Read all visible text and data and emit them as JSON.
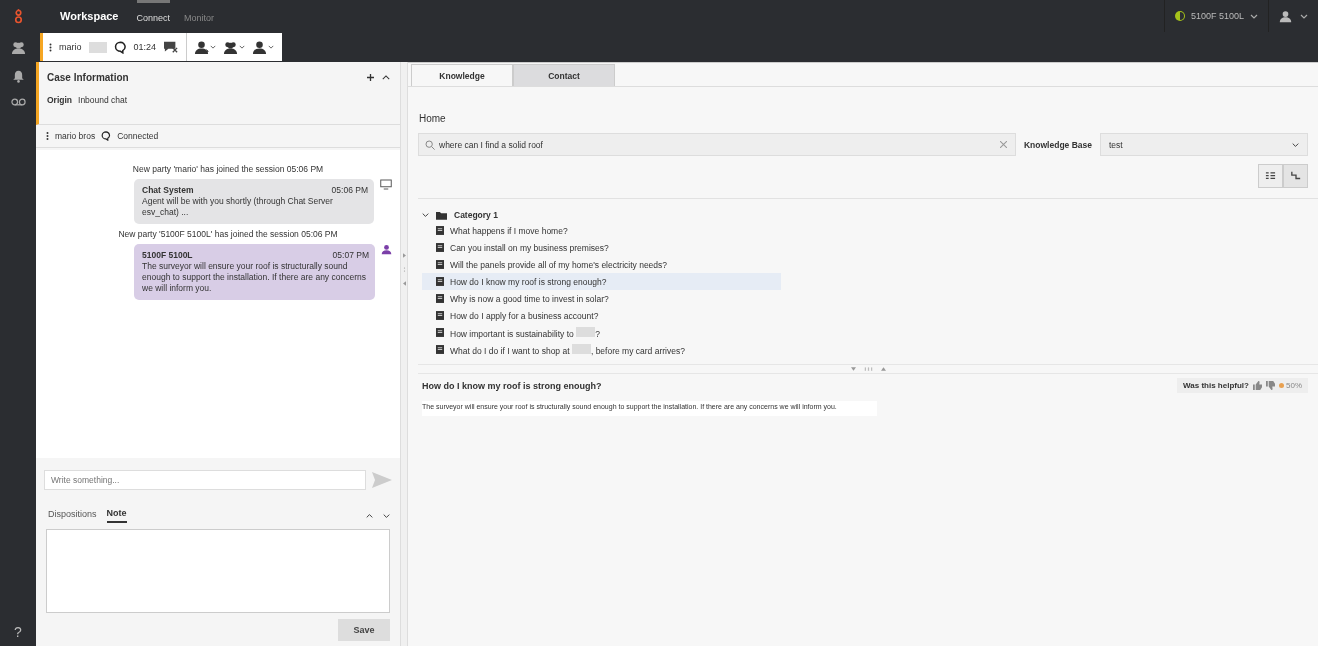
{
  "top_bar": {
    "app_title": "Workspace",
    "nav": [
      {
        "label": "Connect",
        "selected": true
      },
      {
        "label": "Monitor",
        "selected": false
      }
    ],
    "agent_status": {
      "name": "5100F 5100L",
      "color": "#a6c21a"
    }
  },
  "interaction_bar": {
    "contact": "mario",
    "timer": "01:24"
  },
  "case_information": {
    "title": "Case Information",
    "expanded": true,
    "origin_label": "Origin",
    "origin_value": "Inbound chat"
  },
  "party": {
    "name": "mario bros",
    "status": "Connected"
  },
  "transcript": [
    {
      "kind": "notice",
      "text": "New party 'mario' has joined the session 05:06 PM"
    },
    {
      "kind": "system_message",
      "sender": "Chat System",
      "time": "05:06 PM",
      "text": "Agent will be with you shortly (through Chat Server esv_chat) ..."
    },
    {
      "kind": "notice",
      "text": "New party '5100F 5100L' has joined the session 05:06 PM"
    },
    {
      "kind": "agent_message",
      "sender": "5100F 5100L",
      "time": "05:07 PM",
      "text": "The surveyor will ensure your roof is structurally sound enough to support the installation. If there are any concerns we will inform you."
    }
  ],
  "message_input": {
    "placeholder": "Write something..."
  },
  "bottom_tabs": [
    {
      "label": "Dispositions",
      "selected": false
    },
    {
      "label": "Note",
      "selected": true
    }
  ],
  "save_button": "Save",
  "help": "?",
  "knowledge": {
    "tabs": [
      {
        "label": "Knowledge",
        "selected": true
      },
      {
        "label": "Contact",
        "selected": false
      }
    ],
    "breadcrumb": "Home",
    "search": {
      "value": "where can I find a solid roof"
    },
    "kb_label": "Knowledge Base",
    "kb_value": "test",
    "category": {
      "label": "Category 1",
      "expanded": true,
      "articles": [
        {
          "parts": [
            "What happens if I move home?"
          ],
          "selected": false
        },
        {
          "parts": [
            "Can you install on my business premises?"
          ],
          "selected": false
        },
        {
          "parts": [
            "Will the panels provide all of my home's electricity needs?"
          ],
          "selected": false
        },
        {
          "parts": [
            "How do I know my roof is strong enough?"
          ],
          "selected": true
        },
        {
          "parts": [
            "Why is now a good time to invest in solar?"
          ],
          "selected": false
        },
        {
          "parts": [
            "How do I apply for a business account?"
          ],
          "selected": false
        },
        {
          "parts": [
            "How important is sustainability to ",
            "?"
          ],
          "selected": false
        },
        {
          "parts": [
            "What do I do if I want to shop at ",
            ", before my card arrives?"
          ],
          "selected": false
        }
      ]
    },
    "article": {
      "title": "How do I know my roof is strong enough?",
      "body": "The surveyor will ensure your roof is structurally sound enough to support the installation. If there are any concerns we will inform you."
    },
    "feedback": {
      "label": "Was this helpful?",
      "rating": "50%"
    }
  }
}
